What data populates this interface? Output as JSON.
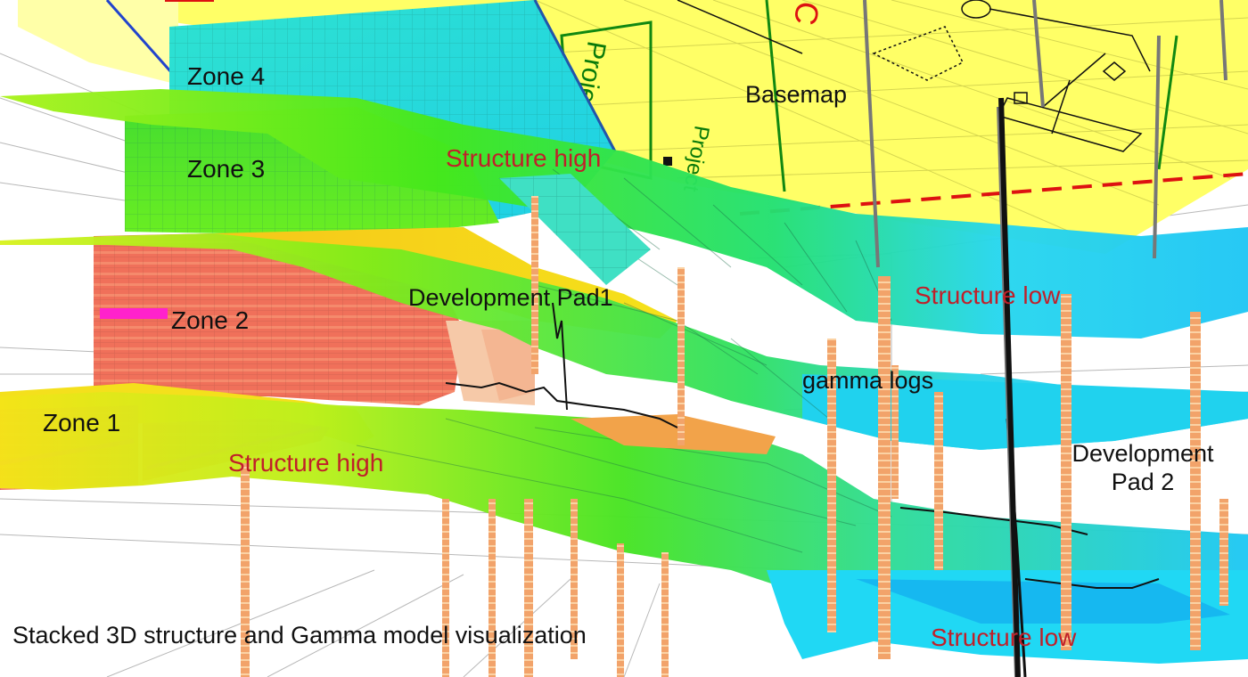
{
  "figure": {
    "caption": "Stacked 3D structure and Gamma model visualization"
  },
  "labels": {
    "zone4": "Zone 4",
    "zone3": "Zone 3",
    "zone2": "Zone 2",
    "zone1": "Zone 1",
    "basemap": "Basemap",
    "structure_high_top": "Structure high",
    "structure_high_bottom": "Structure high",
    "structure_low_top": "Structure low",
    "structure_low_bottom": "Structure low",
    "development_pad1": "Development Pad1",
    "development_pad2_line1": "Development",
    "development_pad2_line2": "Pad 2",
    "gamma_logs": "gamma logs"
  },
  "basemap_text": {
    "project_a": "Project",
    "project_b": "Project",
    "letter": "C"
  },
  "colors": {
    "basemap_yellow": "#ffff66",
    "green_surface": "#44e21a",
    "cyan_surface": "#22d8f0",
    "zone2_orange": "#f06a50",
    "highlight_magenta": "#ff22cc",
    "well_log_orange": "#f0a060",
    "label_red": "#c0202a"
  }
}
